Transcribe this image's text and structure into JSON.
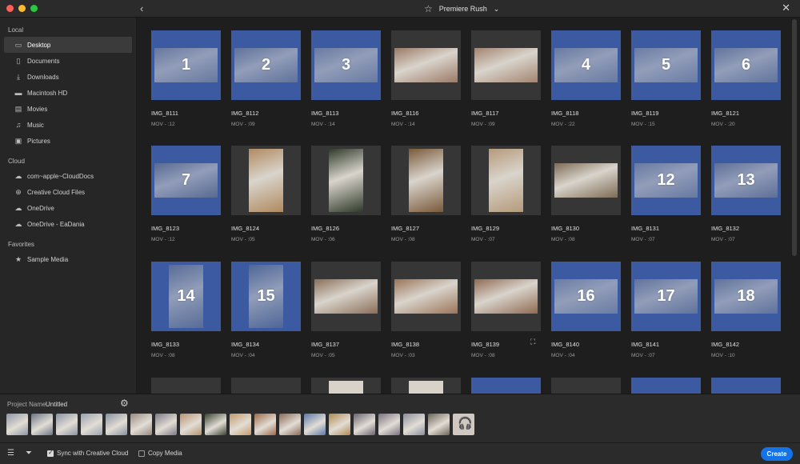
{
  "window": {
    "title": "Premiere Rush"
  },
  "sidebar": {
    "sections": [
      {
        "title": "Local",
        "items": [
          {
            "label": "Desktop",
            "icon": "desktop-icon",
            "active": true
          },
          {
            "label": "Documents",
            "icon": "document-icon"
          },
          {
            "label": "Downloads",
            "icon": "download-icon"
          },
          {
            "label": "Macintosh HD",
            "icon": "drive-icon"
          },
          {
            "label": "Movies",
            "icon": "film-icon"
          },
          {
            "label": "Music",
            "icon": "music-icon"
          },
          {
            "label": "Pictures",
            "icon": "picture-icon"
          }
        ]
      },
      {
        "title": "Cloud",
        "items": [
          {
            "label": "com~apple~CloudDocs",
            "icon": "cloud-icon"
          },
          {
            "label": "Creative Cloud Files",
            "icon": "creative-cloud-icon"
          },
          {
            "label": "OneDrive",
            "icon": "cloud-icon"
          },
          {
            "label": "OneDrive - EaDania",
            "icon": "cloud-icon"
          }
        ]
      },
      {
        "title": "Favorites",
        "items": [
          {
            "label": "Sample Media",
            "icon": "star-icon"
          }
        ]
      }
    ]
  },
  "grid": {
    "items": [
      {
        "name": "IMG_8111",
        "meta": "MOV - :12",
        "selected": true,
        "number": "1"
      },
      {
        "name": "IMG_8112",
        "meta": "MOV - :09",
        "selected": true,
        "number": "2"
      },
      {
        "name": "IMG_8113",
        "meta": "MOV - :14",
        "selected": true,
        "number": "3"
      },
      {
        "name": "IMG_8116",
        "meta": "MOV - :14",
        "selected": false,
        "number": ""
      },
      {
        "name": "IMG_8117",
        "meta": "MOV - :09",
        "selected": false,
        "number": ""
      },
      {
        "name": "IMG_8118",
        "meta": "MOV - :22",
        "selected": true,
        "number": "4"
      },
      {
        "name": "IMG_8119",
        "meta": "MOV - :15",
        "selected": true,
        "number": "5"
      },
      {
        "name": "IMG_8121",
        "meta": "MOV - :20",
        "selected": true,
        "number": "6"
      },
      {
        "name": "IMG_8123",
        "meta": "MOV - :12",
        "selected": true,
        "number": "7"
      },
      {
        "name": "IMG_8124",
        "meta": "MOV - :05",
        "selected": false,
        "number": ""
      },
      {
        "name": "IMG_8126",
        "meta": "MOV - :06",
        "selected": false,
        "number": ""
      },
      {
        "name": "IMG_8127",
        "meta": "MOV - :08",
        "selected": false,
        "number": ""
      },
      {
        "name": "IMG_8129",
        "meta": "MOV - :07",
        "selected": false,
        "number": ""
      },
      {
        "name": "IMG_8130",
        "meta": "MOV - :08",
        "selected": false,
        "number": ""
      },
      {
        "name": "IMG_8131",
        "meta": "MOV - :07",
        "selected": true,
        "number": "12"
      },
      {
        "name": "IMG_8132",
        "meta": "MOV - :07",
        "selected": true,
        "number": "13"
      },
      {
        "name": "IMG_8133",
        "meta": "MOV - :08",
        "selected": true,
        "number": "14"
      },
      {
        "name": "IMG_8134",
        "meta": "MOV - :04",
        "selected": true,
        "number": "15"
      },
      {
        "name": "IMG_8137",
        "meta": "MOV - :05",
        "selected": false,
        "number": ""
      },
      {
        "name": "IMG_8138",
        "meta": "MOV - :03",
        "selected": false,
        "number": ""
      },
      {
        "name": "IMG_8139",
        "meta": "MOV - :08",
        "selected": false,
        "number": ""
      },
      {
        "name": "IMG_8140",
        "meta": "MOV - :04",
        "selected": true,
        "number": "16"
      },
      {
        "name": "IMG_8141",
        "meta": "MOV - :07",
        "selected": true,
        "number": "17"
      },
      {
        "name": "IMG_8142",
        "meta": "MOV - :10",
        "selected": true,
        "number": "18"
      }
    ],
    "partial_row_selected": [
      false,
      false,
      false,
      false,
      true,
      false,
      true,
      true
    ]
  },
  "project": {
    "label": "Project Name",
    "value": "Untitled"
  },
  "options": {
    "sync_label": "Sync with Creative Cloud",
    "sync_checked": true,
    "copy_label": "Copy Media",
    "copy_checked": false
  },
  "buttons": {
    "create": "Create"
  },
  "colors": {
    "selected": "#3b5aa1",
    "accent": "#1473e6",
    "tile": "#363636"
  }
}
